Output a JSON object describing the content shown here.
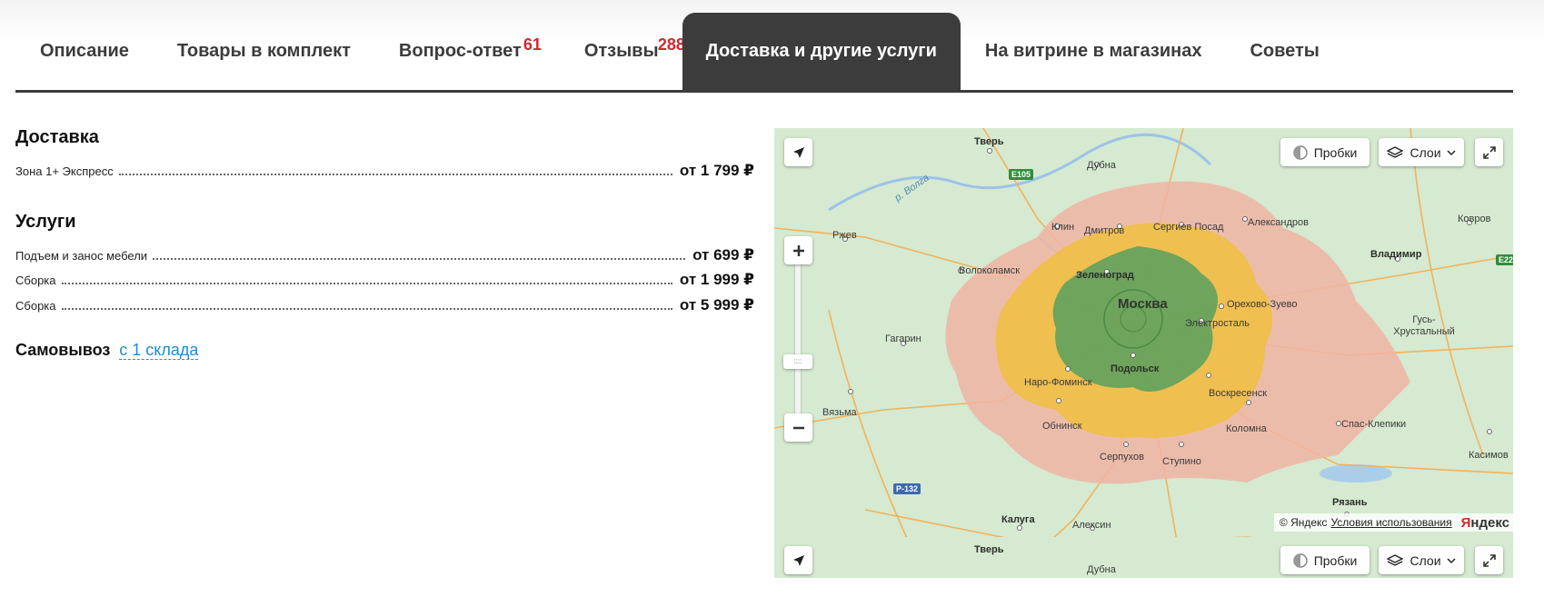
{
  "tabs": [
    {
      "label": "Описание",
      "badge": ""
    },
    {
      "label": "Товары в комплект",
      "badge": ""
    },
    {
      "label": "Вопрос-ответ",
      "badge": "61"
    },
    {
      "label": "Отзывы",
      "badge": "288"
    },
    {
      "label": "Доставка и другие услуги",
      "badge": "",
      "active": true
    },
    {
      "label": "На витрине в магазинах",
      "badge": ""
    },
    {
      "label": "Советы",
      "badge": ""
    }
  ],
  "delivery": {
    "title": "Доставка",
    "items": [
      {
        "label": "Зона 1+ Экспресс",
        "price": "от 1 799 ₽"
      }
    ]
  },
  "services": {
    "title": "Услуги",
    "items": [
      {
        "label": "Подъем и занос мебели",
        "price": "от 699 ₽"
      },
      {
        "label": "Сборка",
        "price": "от 1 999 ₽"
      },
      {
        "label": "Сборка",
        "price": "от 5 999 ₽"
      }
    ]
  },
  "pickup": {
    "label": "Самовывоз",
    "link": "с 1 склада"
  },
  "map": {
    "controls": {
      "traffic": "Пробки",
      "layers": "Слои",
      "zoom_handle": "::::"
    },
    "cities": {
      "tver": "Тверь",
      "dubna": "Дубна",
      "volga": "р. Волга",
      "klin": "Клин",
      "dmitrov": "Дмитров",
      "sergiev": "Сергиев Посад",
      "alexandrov": "Александров",
      "kovrov": "Ковров",
      "rzhev": "Ржев",
      "vladimir": "Владимир",
      "volokolamsk": "Волоколамск",
      "zelenograd": "Зеленоград",
      "moskva": "Москва",
      "orekhovo": "Орехово-Зуево",
      "elektrostal": "Электросталь",
      "gagarin": "Гагарин",
      "gus": "Гусь-Хрустальный",
      "naro": "Наро-Фоминск",
      "podolsk": "Подольск",
      "voskresensk": "Воскресенск",
      "vyazma": "Вязьма",
      "obninsk": "Обнинск",
      "kolomna": "Коломна",
      "spas": "Спас-Клепики",
      "kasimov": "Касимов",
      "serpukhov": "Серпухов",
      "stupino": "Ступино",
      "ryazan": "Рязань",
      "kaluga": "Калуга",
      "aleksin": "Алексин",
      "tver2": "Тверь",
      "dubna2": "Дубна"
    },
    "roads": {
      "e105": "E105",
      "r132": "Р-132",
      "e22": "E22"
    },
    "copyright": "© Яндекс",
    "terms": "Условия использования",
    "logo_y": "Я",
    "logo_rest": "ндекс"
  },
  "colors": {
    "tab_active_bg": "#3c3c3c",
    "badge": "#d3262c",
    "link": "#1a8ed4",
    "zone_green": "#5fa15c",
    "zone_yellow": "#f0c040",
    "zone_pink": "#f0b4a4"
  },
  "icons": {
    "locate": "arrow-locate-icon",
    "traffic": "traffic-icon",
    "layers": "layers-icon",
    "fullscreen": "fullscreen-icon",
    "zoom_in": "plus-icon",
    "zoom_out": "minus-icon"
  }
}
